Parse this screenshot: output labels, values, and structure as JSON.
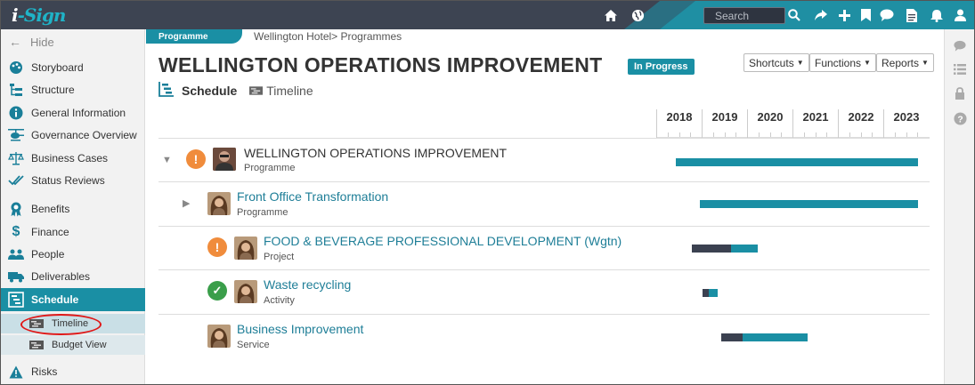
{
  "app": {
    "logo_prefix": "i",
    "logo_main": "-Sign"
  },
  "topbar": {
    "search_placeholder": "Search",
    "icons": [
      "home-icon",
      "globe-icon",
      "search-icon",
      "share-icon",
      "plus-icon",
      "bookmark-icon",
      "chat-icon",
      "document-icon",
      "bell-icon",
      "user-icon"
    ]
  },
  "sidebar": {
    "hide_label": "Hide",
    "items": [
      {
        "label": "Storyboard",
        "icon": "palette-icon"
      },
      {
        "label": "Structure",
        "icon": "structure-icon"
      },
      {
        "label": "General Information",
        "icon": "info-icon"
      },
      {
        "label": "Governance Overview",
        "icon": "helicopter-icon"
      },
      {
        "label": "Business Cases",
        "icon": "scales-icon"
      },
      {
        "label": "Status Reviews",
        "icon": "checks-icon"
      },
      {
        "label": "Benefits",
        "icon": "award-icon"
      },
      {
        "label": "Finance",
        "icon": "dollar-icon"
      },
      {
        "label": "People",
        "icon": "people-icon"
      },
      {
        "label": "Deliverables",
        "icon": "truck-icon"
      },
      {
        "label": "Schedule",
        "icon": "schedule-icon"
      },
      {
        "label": "Risks",
        "icon": "warning-icon"
      }
    ],
    "subitems": [
      {
        "label": "Timeline"
      },
      {
        "label": "Budget View"
      }
    ]
  },
  "main": {
    "tab_label": "Programme",
    "breadcrumb": "Wellington Hotel> Programmes",
    "title": "WELLINGTON OPERATIONS IMPROVEMENT",
    "status": "In Progress",
    "buttons": {
      "shortcuts": "Shortcuts",
      "functions": "Functions",
      "reports": "Reports"
    },
    "view_schedule": "Schedule",
    "view_timeline": "Timeline",
    "years": [
      "2018",
      "2019",
      "2020",
      "2021",
      "2022",
      "2023"
    ],
    "rows": [
      {
        "name": "WELLINGTON OPERATIONS IMPROVEMENT",
        "type": "Programme",
        "status": "warning",
        "progress": 0.0
      },
      {
        "name": "Front Office Transformation",
        "type": "Programme",
        "status": "none",
        "progress": 0.0
      },
      {
        "name": "FOOD & BEVERAGE PROFESSIONAL DEVELOPMENT (Wgtn)",
        "type": "Project",
        "status": "warning",
        "progress": 0.6
      },
      {
        "name": "Waste recycling",
        "type": "Activity",
        "status": "ok",
        "progress": 0.4
      },
      {
        "name": "Business Improvement",
        "type": "Service",
        "status": "none",
        "progress": 0.25
      }
    ]
  },
  "colors": {
    "accent": "#1a8fa4",
    "topbar": "#3d4452",
    "warning": "#f08c3c",
    "ok": "#3a9e4a",
    "bar_done": "#3b4150"
  }
}
